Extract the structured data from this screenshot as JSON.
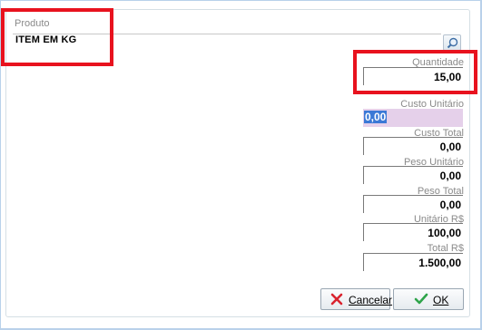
{
  "produto": {
    "label": "Produto",
    "value": "ITEM EM KG"
  },
  "fields": [
    {
      "label": "Quantidade",
      "value": "15,00"
    },
    {
      "label": "Custo Unitário",
      "value": "0,00"
    },
    {
      "label": "Custo Total",
      "value": "0,00"
    },
    {
      "label": "Peso Unitário",
      "value": "0,00"
    },
    {
      "label": "Peso Total",
      "value": "0,00"
    },
    {
      "label": "Unitário R$",
      "value": "100,00"
    },
    {
      "label": "Total R$",
      "value": "1.500,00"
    }
  ],
  "buttons": {
    "cancel_label": "Cancelar",
    "ok_label": "OK"
  },
  "colors": {
    "highlight": "#e8121e",
    "selection": "#3b79d6",
    "focus_field_bg": "#e5d0ea"
  },
  "icons": {
    "lookup": "magnifier-icon",
    "cancel": "x-icon",
    "ok": "checkmark-icon"
  }
}
